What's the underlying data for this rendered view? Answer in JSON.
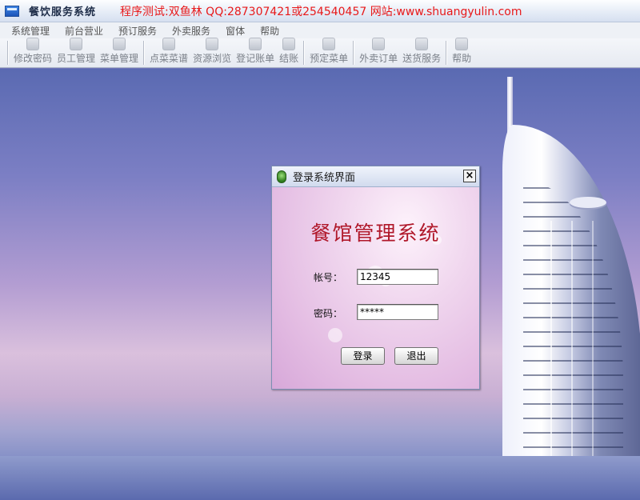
{
  "window": {
    "app_title": "餐饮服务系统",
    "banner": "程序测试:双鱼林 QQ:287307421或254540457 网站:www.shuangyulin.com",
    "banner_color": "#e8191a"
  },
  "menu": {
    "items": [
      "系统管理",
      "前台营业",
      "预订服务",
      "外卖服务",
      "窗体",
      "帮助"
    ]
  },
  "toolbar": {
    "groups": [
      [
        {
          "label": "修改密码",
          "icon": "key-icon"
        },
        {
          "label": "员工管理",
          "icon": "staff-icon"
        },
        {
          "label": "菜单管理",
          "icon": "menu-book-icon"
        }
      ],
      [
        {
          "label": "点菜菜谱",
          "icon": "order-dish-icon"
        },
        {
          "label": "资源浏览",
          "icon": "browse-icon"
        },
        {
          "label": "登记账单",
          "icon": "bill-icon"
        },
        {
          "label": "结账",
          "icon": "checkout-icon"
        }
      ],
      [
        {
          "label": "预定菜单",
          "icon": "reserve-icon"
        }
      ],
      [
        {
          "label": "外卖订单",
          "icon": "takeout-icon"
        },
        {
          "label": "送货服务",
          "icon": "delivery-icon"
        }
      ],
      [
        {
          "label": "帮助",
          "icon": "help-icon"
        }
      ]
    ]
  },
  "login": {
    "title": "登录系统界面",
    "close_glyph": "×",
    "heading": "餐馆管理系统",
    "heading_color": "#b0182a",
    "account_label": "帐号：",
    "account_value": "12345",
    "password_label": "密码：",
    "password_value": "*****",
    "login_button": "登录",
    "exit_button": "退出"
  }
}
